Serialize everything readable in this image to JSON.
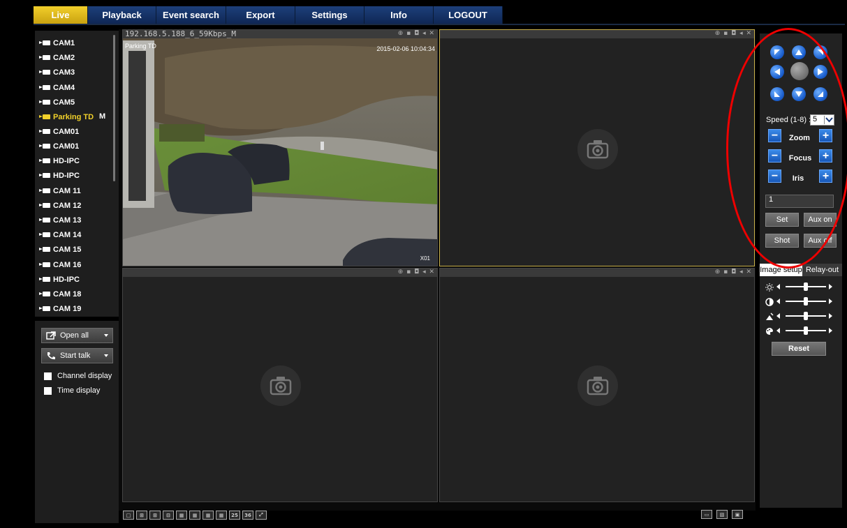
{
  "nav": {
    "tabs": [
      {
        "label": "Live",
        "active": true
      },
      {
        "label": "Playback"
      },
      {
        "label": "Event search"
      },
      {
        "label": "Export"
      },
      {
        "label": "Settings"
      },
      {
        "label": "Info"
      },
      {
        "label": "LOGOUT"
      }
    ]
  },
  "channels": [
    {
      "label": "CAM1"
    },
    {
      "label": "CAM2"
    },
    {
      "label": "CAM3"
    },
    {
      "label": "CAM4"
    },
    {
      "label": "CAM5"
    },
    {
      "label": "Parking TD",
      "selected": true,
      "badge": "M"
    },
    {
      "label": "CAM01"
    },
    {
      "label": "CAM01"
    },
    {
      "label": "HD-IPC"
    },
    {
      "label": "HD-IPC"
    },
    {
      "label": "CAM 11"
    },
    {
      "label": "CAM 12"
    },
    {
      "label": "CAM 13"
    },
    {
      "label": "CAM 14"
    },
    {
      "label": "CAM 15"
    },
    {
      "label": "CAM 16"
    },
    {
      "label": "HD-IPC"
    },
    {
      "label": "CAM 18"
    },
    {
      "label": "CAM 19"
    }
  ],
  "controls": {
    "open_all": "Open all",
    "start_talk": "Start talk",
    "channel_display": "Channel display",
    "time_display": "Time display"
  },
  "video": {
    "stream_info": "192.168.5.188_6_59Kbps_M",
    "osd_name": "Parking TD",
    "timestamp": "2015-02-06 10:04:34",
    "channel_tag": "X01"
  },
  "layout_buttons": [
    "1",
    "4",
    "6",
    "8",
    "9",
    "10",
    "13",
    "16",
    "25",
    "36",
    "full"
  ],
  "ptz": {
    "speed_label": "Speed (1-8) :",
    "speed_value": "5",
    "zoom_label": "Zoom",
    "focus_label": "Focus",
    "iris_label": "Iris",
    "preset_value": "1",
    "set_label": "Set",
    "aux_on_label": "Aux on",
    "shot_label": "Shot",
    "aux_off_label": "Aux off"
  },
  "image_setup": {
    "tab_image": "Image setup",
    "tab_relay": "Relay-out",
    "sliders": [
      {
        "name": "brightness",
        "icon": "sun-icon",
        "value": 0.5
      },
      {
        "name": "contrast",
        "icon": "contrast-icon",
        "value": 0.5
      },
      {
        "name": "saturation",
        "icon": "saturation-icon",
        "value": 0.5
      },
      {
        "name": "hue",
        "icon": "palette-icon",
        "value": 0.5
      }
    ],
    "reset_label": "Reset"
  },
  "colors": {
    "accent": "#f2d12a",
    "nav_blue": "#15346a",
    "ptz_blue": "#1b5fcf"
  }
}
